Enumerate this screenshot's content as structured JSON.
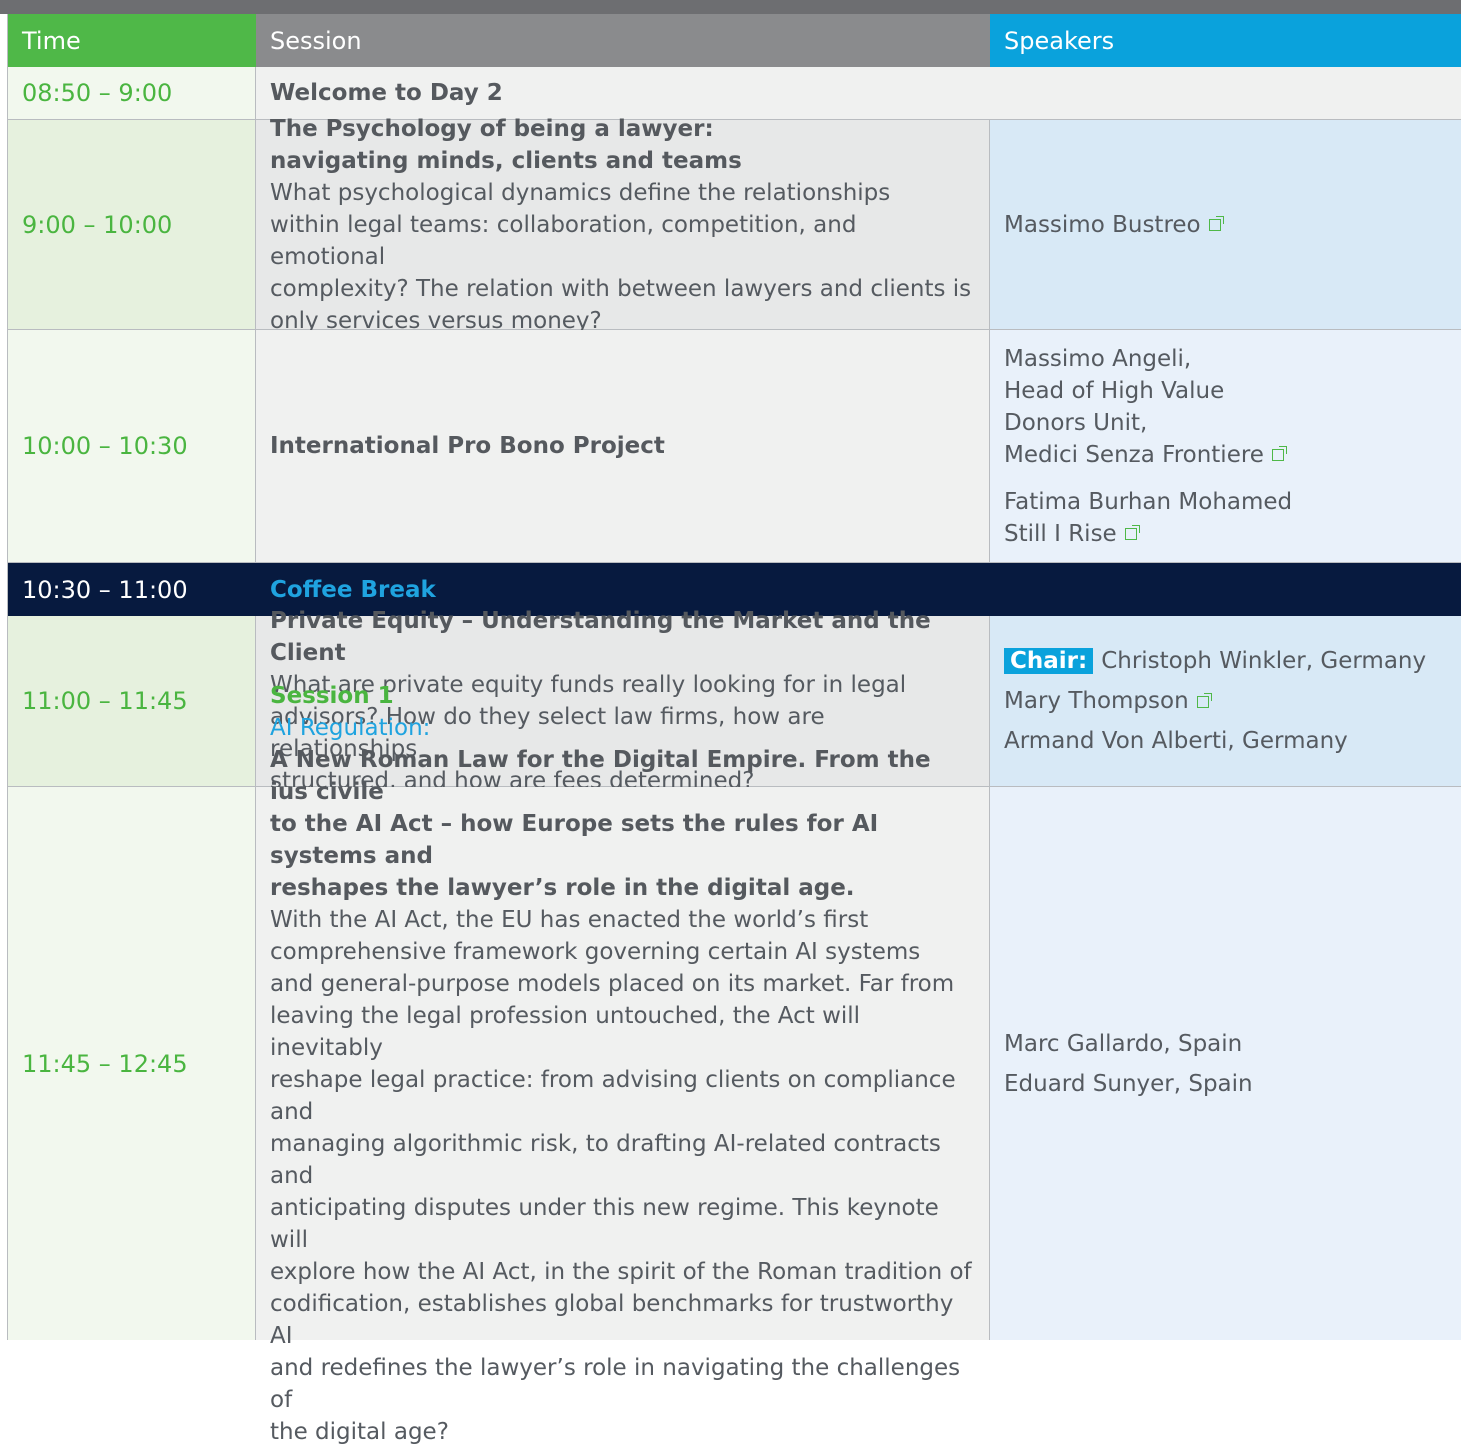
{
  "header": {
    "time": "Time",
    "session": "Session",
    "speakers": "Speakers"
  },
  "rows": {
    "r1": {
      "time": "08:50 – 9:00",
      "title": "Welcome to Day 2"
    },
    "r2": {
      "time": "9:00 – 10:00",
      "title_1": "The Psychology of being a lawyer:",
      "title_2": "navigating minds, clients and teams",
      "desc_1": "What psychological dynamics define the relationships",
      "desc_2": "within legal teams: collaboration, competition, and emotional",
      "desc_3": "complexity? The relation with between lawyers and clients is",
      "desc_4": "only services versus money?",
      "speaker": "Massimo Bustreo"
    },
    "r3": {
      "time": "10:00 – 10:30",
      "title": "International Pro Bono Project",
      "sp1_1": "Massimo Angeli,",
      "sp1_2": "Head of High Value",
      "sp1_3": "Donors Unit,",
      "sp1_4": "Medici Senza Frontiere",
      "sp2_1": "Fatima Burhan Mohamed",
      "sp2_2": "Still I Rise"
    },
    "r4": {
      "time": "10:30 – 11:00",
      "title": "Coffee Break"
    },
    "r5": {
      "time": "11:00 – 11:45",
      "title": "Private Equity – Understanding the Market and the Client",
      "desc_1": "What are private equity funds really looking for in legal",
      "desc_2": "advisors? How do they select law firms, how are relationships",
      "desc_3": "structured, and how are fees determined?",
      "chair_label": "Chair:",
      "chair_name": "Christoph Winkler, Germany",
      "sp1": "Mary Thompson",
      "sp2": "Armand Von Alberti, Germany"
    },
    "r6": {
      "time": "11:45 – 12:45",
      "session_label": "Session 1",
      "topic": "AI Regulation:",
      "title_1": "A New Roman Law for the Digital Empire. From the ius civile",
      "title_2": "to the AI Act – how Europe sets the rules for AI systems and",
      "title_3": "reshapes the lawyer’s role in the digital age.",
      "desc_1": "With the AI Act, the EU has enacted the world’s first",
      "desc_2": "comprehensive framework governing certain AI systems",
      "desc_3": "and general-purpose models placed on its market. Far from",
      "desc_4": "leaving the legal profession untouched, the Act will inevitably",
      "desc_5": "reshape legal practice: from advising clients on compliance and",
      "desc_6": "managing algorithmic risk, to drafting AI-related contracts and",
      "desc_7": "anticipating disputes under this new regime. This keynote will",
      "desc_8": "explore how the AI Act, in the spirit of the Roman tradition of",
      "desc_9": "codification, establishes global benchmarks for trustworthy AI",
      "desc_10": "and redefines the lawyer’s role in navigating the challenges of",
      "desc_11": "the digital age?",
      "sp1": "Marc Gallardo, Spain",
      "sp2": "Eduard Sunyer, Spain"
    }
  }
}
